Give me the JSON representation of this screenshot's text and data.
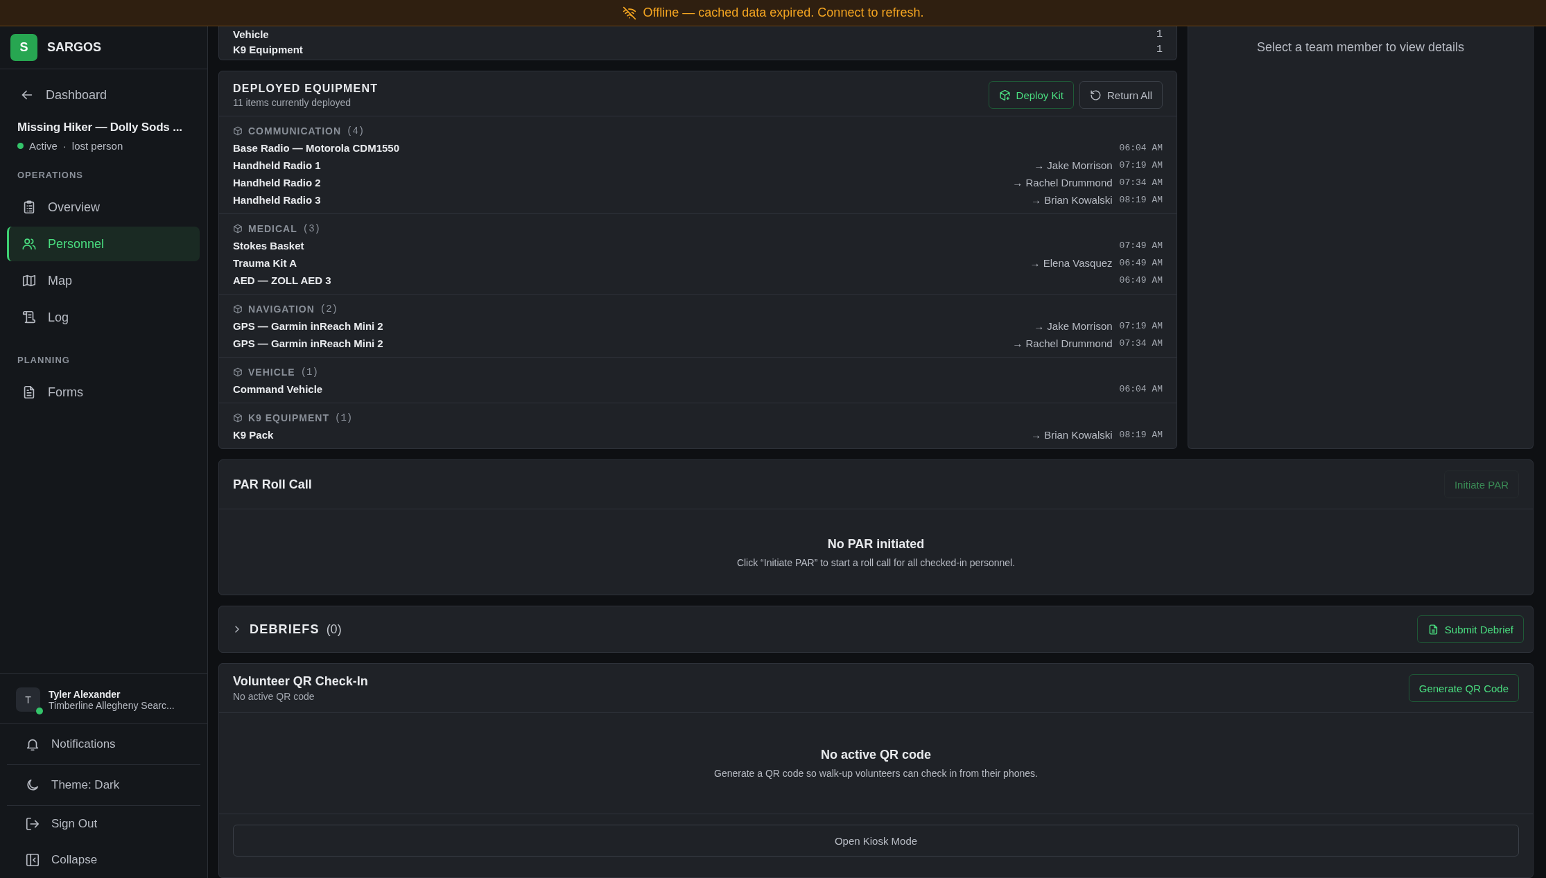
{
  "banner": {
    "text": "Offline — cached data expired. Connect to refresh."
  },
  "sidebar": {
    "brand": {
      "initial": "S",
      "name": "SARGOS"
    },
    "back_link": "Dashboard",
    "incident": {
      "title": "Missing Hiker — Dolly Sods ...",
      "status": "Active",
      "active": true,
      "separator": "·",
      "type": "lost person"
    },
    "sections": [
      {
        "heading": "OPERATIONS",
        "items": [
          {
            "label": "Overview",
            "kind": "overview",
            "selected": false
          },
          {
            "label": "Personnel",
            "kind": "personnel",
            "selected": true
          },
          {
            "label": "Map",
            "kind": "map",
            "selected": false
          },
          {
            "label": "Log",
            "kind": "log",
            "selected": false
          }
        ]
      },
      {
        "heading": "PLANNING",
        "items": [
          {
            "label": "Forms",
            "kind": "forms",
            "selected": false
          }
        ]
      }
    ],
    "user": {
      "initial": "T",
      "name": "Tyler Alexander",
      "org": "Timberline Allegheny Searc...",
      "online": true
    },
    "footer_items": [
      {
        "label": "Notifications",
        "kind": "notifications"
      },
      {
        "label": "Theme: Dark",
        "kind": "theme"
      },
      {
        "label": "Sign Out",
        "kind": "signout"
      },
      {
        "label": "Collapse",
        "kind": "collapse"
      }
    ]
  },
  "summary": {
    "rows": [
      {
        "label": "Vehicle",
        "count": "1"
      },
      {
        "label": "K9 Equipment",
        "count": "1"
      }
    ]
  },
  "deployed": {
    "title": "DEPLOYED EQUIPMENT",
    "subtitle": "11 items currently deployed",
    "buttons": [
      {
        "label": "Deploy Kit",
        "kind": "deploy"
      },
      {
        "label": "Return All",
        "kind": "return"
      }
    ],
    "groups": [
      {
        "name": "COMMUNICATION",
        "count": "(4)",
        "items": [
          {
            "name": "Base Radio — Motorola CDM1550",
            "time": "06:04 AM"
          },
          {
            "name": "Handheld Radio 1",
            "assignee": "→ Jake Morrison",
            "time": "07:19 AM"
          },
          {
            "name": "Handheld Radio 2",
            "assignee": "→ Rachel Drummond",
            "time": "07:34 AM"
          },
          {
            "name": "Handheld Radio 3",
            "assignee": "→ Brian Kowalski",
            "time": "08:19 AM"
          }
        ]
      },
      {
        "name": "MEDICAL",
        "count": "(3)",
        "items": [
          {
            "name": "Stokes Basket",
            "time": "07:49 AM"
          },
          {
            "name": "Trauma Kit A",
            "assignee": "→ Elena Vasquez",
            "time": "06:49 AM"
          },
          {
            "name": "AED — ZOLL AED 3",
            "time": "06:49 AM"
          }
        ]
      },
      {
        "name": "NAVIGATION",
        "count": "(2)",
        "items": [
          {
            "name": "GPS — Garmin inReach Mini 2",
            "assignee": "→ Jake Morrison",
            "time": "07:19 AM"
          },
          {
            "name": "GPS — Garmin inReach Mini 2",
            "assignee": "→ Rachel Drummond",
            "time": "07:34 AM"
          }
        ]
      },
      {
        "name": "VEHICLE",
        "count": "(1)",
        "items": [
          {
            "name": "Command Vehicle",
            "time": "06:04 AM"
          }
        ]
      },
      {
        "name": "K9 EQUIPMENT",
        "count": "(1)",
        "items": [
          {
            "name": "K9 Pack",
            "assignee": "→ Brian Kowalski",
            "time": "08:19 AM"
          }
        ]
      }
    ]
  },
  "details_panel": {
    "placeholder": "Select a team member to view details"
  },
  "par": {
    "title": "PAR Roll Call",
    "button": {
      "label": "Initiate PAR",
      "disabled": true
    },
    "empty_title": "No PAR initiated",
    "empty_text": "Click “Initiate PAR” to start a roll call for all checked-in personnel."
  },
  "debriefs": {
    "title": "DEBRIEFS",
    "count": "(0)",
    "expanded": false,
    "button": "Submit Debrief"
  },
  "qr": {
    "title": "Volunteer QR Check-In",
    "subtitle": "No active QR code",
    "button": "Generate QR Code",
    "empty_title": "No active QR code",
    "empty_text": "Generate a QR code so walk-up volunteers can check in from their phones.",
    "kiosk_button": "Open Kiosk Mode"
  }
}
